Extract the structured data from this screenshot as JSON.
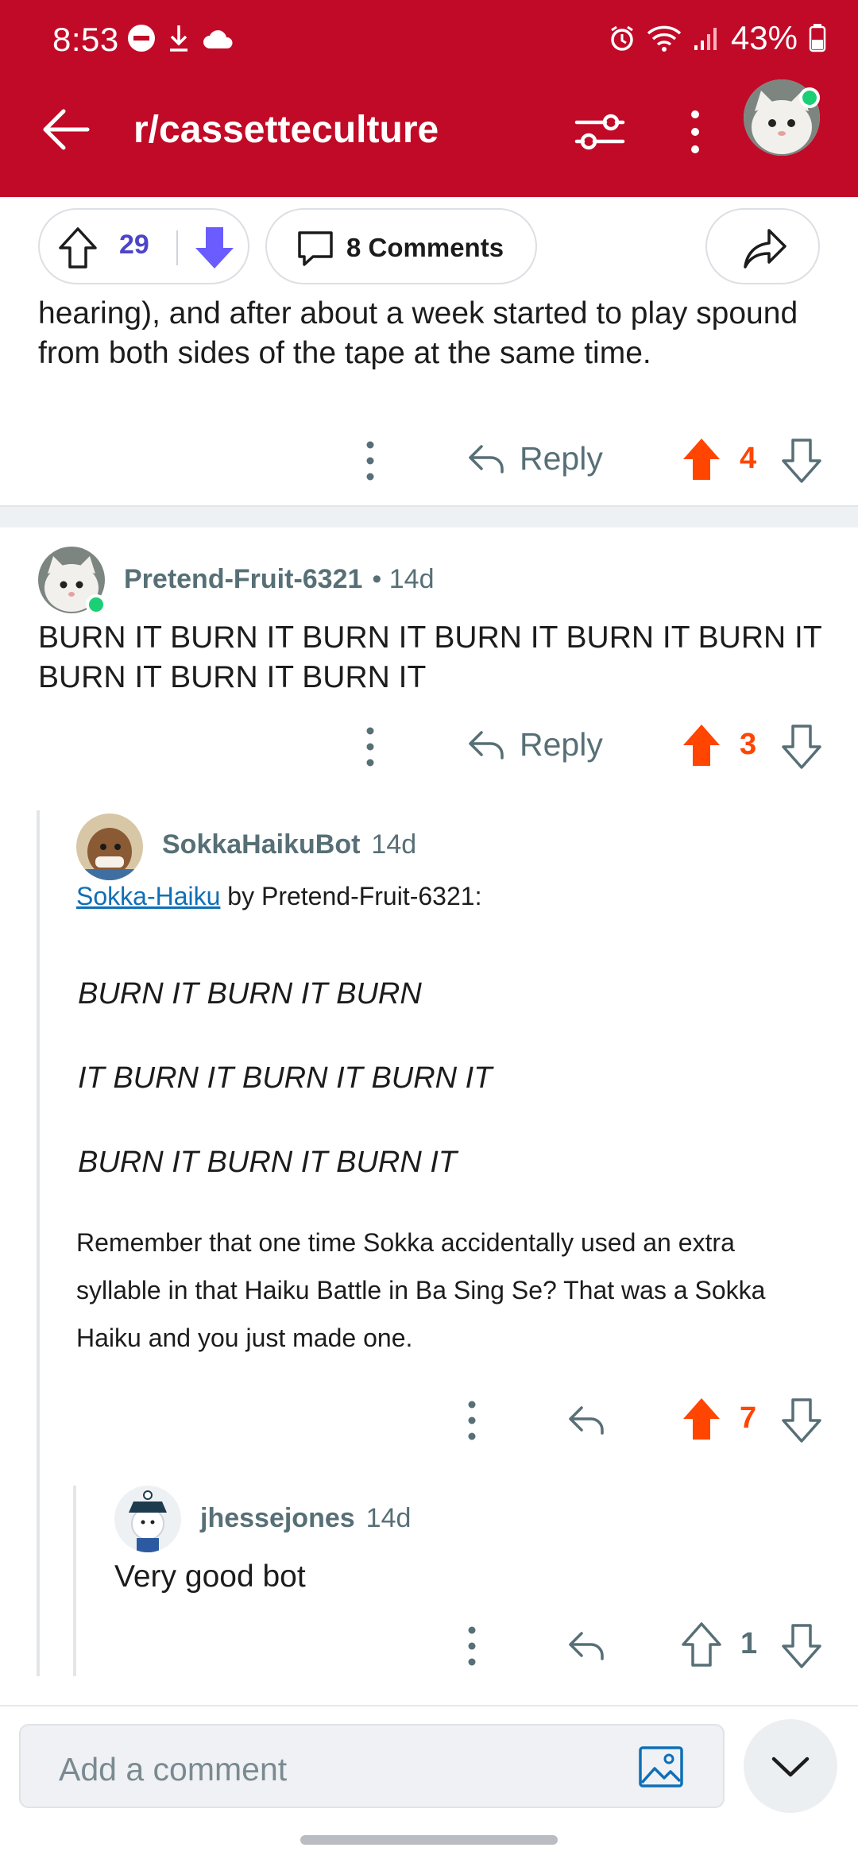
{
  "status_bar": {
    "time": "8:53",
    "battery": "43%"
  },
  "header": {
    "title": "r/cassetteculture",
    "background_color": "#c10a27"
  },
  "post_actions": {
    "score": "29",
    "comments_label": "8 Comments"
  },
  "comments": [
    {
      "text": "hearing), and after about a week started to play spound from both sides of the tape at the same time.",
      "reply_label": "Reply",
      "score": "4"
    },
    {
      "author": "Pretend-Fruit-6321",
      "age": "• 14d",
      "text": "BURN IT BURN IT BURN IT BURN IT BURN IT BURN IT BURN IT BURN IT BURN IT",
      "reply_label": "Reply",
      "score": "3"
    },
    {
      "author": "SokkaHaikuBot",
      "age": "14d",
      "link_text": "Sokka-Haiku",
      "byline": " by Pretend-Fruit-6321:",
      "haiku_lines": [
        "BURN IT BURN IT BURN",
        "IT BURN IT BURN IT BURN IT",
        "BURN IT BURN IT BURN IT"
      ],
      "note": "Remember that one time Sokka accidentally used an extra syllable in that Haiku Battle in Ba Sing Se? That was a Sokka Haiku and you just made one.",
      "score": "7"
    },
    {
      "author": "jhessejones",
      "age": "14d",
      "text": "Very good bot",
      "score": "1"
    }
  ],
  "composer": {
    "placeholder": "Add a comment"
  },
  "colors": {
    "upvote_active": "#ff4500",
    "vote_count": "#4d45c8",
    "link": "#0f6fb7"
  },
  "icons": [
    "back-arrow-icon",
    "filter-icon",
    "more-vert-icon",
    "upvote-icon",
    "downvote-icon",
    "comment-icon",
    "share-icon",
    "reply-icon",
    "image-icon",
    "chevron-down-icon"
  ]
}
